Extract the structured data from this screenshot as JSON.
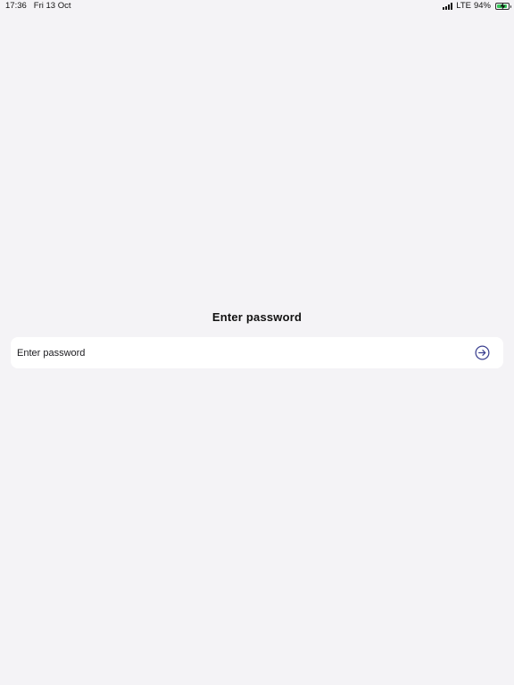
{
  "status_bar": {
    "time": "17:36",
    "date": "Fri 13 Oct",
    "network": "LTE",
    "battery_percent": "94%",
    "battery_level": 0.94,
    "battery_color": "#34c759"
  },
  "login": {
    "title": "Enter password",
    "password_placeholder": "Enter password",
    "password_value": "",
    "submit_icon": "arrow-right-circle-icon",
    "accent_color": "#3a3f8f"
  }
}
